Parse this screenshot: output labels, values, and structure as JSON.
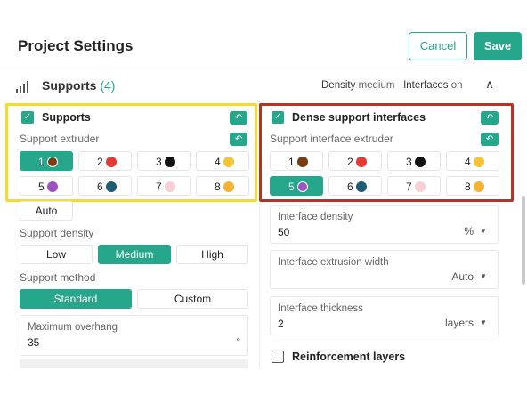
{
  "header": {
    "title": "Project Settings",
    "cancel_label": "Cancel",
    "save_label": "Save"
  },
  "section": {
    "title": "Supports",
    "count": "(4)",
    "summary": [
      {
        "key": "Density",
        "value": "medium"
      },
      {
        "key": "Interfaces",
        "value": "on"
      }
    ]
  },
  "left": {
    "supports_label": "Supports",
    "supports_checked": true,
    "extruder_label": "Support extruder",
    "extruder_selected": "1",
    "auto_label": "Auto",
    "density_label": "Support density",
    "density_options": [
      "Low",
      "Medium",
      "High"
    ],
    "density_selected": "Medium",
    "method_label": "Support method",
    "method_options": [
      "Standard",
      "Custom"
    ],
    "method_selected": "Standard",
    "overhang_label": "Maximum overhang",
    "overhang_value": "35",
    "overhang_unit": "°"
  },
  "right": {
    "dense_label": "Dense support interfaces",
    "dense_checked": true,
    "extruder_label": "Support interface extruder",
    "extruder_selected": "5",
    "interface_density_label": "Interface density",
    "interface_density_value": "50",
    "interface_density_unit": "%",
    "extrusion_width_label": "Interface extrusion width",
    "extrusion_width_value": "Auto",
    "thickness_label": "Interface thickness",
    "thickness_value": "2",
    "thickness_unit": "layers",
    "reinforcement_label": "Reinforcement layers",
    "reinforcement_checked": false
  },
  "extruders": [
    {
      "num": "1",
      "color": "#7a3b0e"
    },
    {
      "num": "2",
      "color": "#e53935"
    },
    {
      "num": "3",
      "color": "#111111"
    },
    {
      "num": "4",
      "color": "#f5c431"
    },
    {
      "num": "5",
      "color": "#a150c4"
    },
    {
      "num": "6",
      "color": "#1e5b75"
    },
    {
      "num": "7",
      "color": "#f7cfd4"
    },
    {
      "num": "8",
      "color": "#f5b32e"
    }
  ],
  "colors": {
    "accent": "#26a68a",
    "highlight_yellow": "#f2dc2c",
    "highlight_red": "#b53428"
  }
}
